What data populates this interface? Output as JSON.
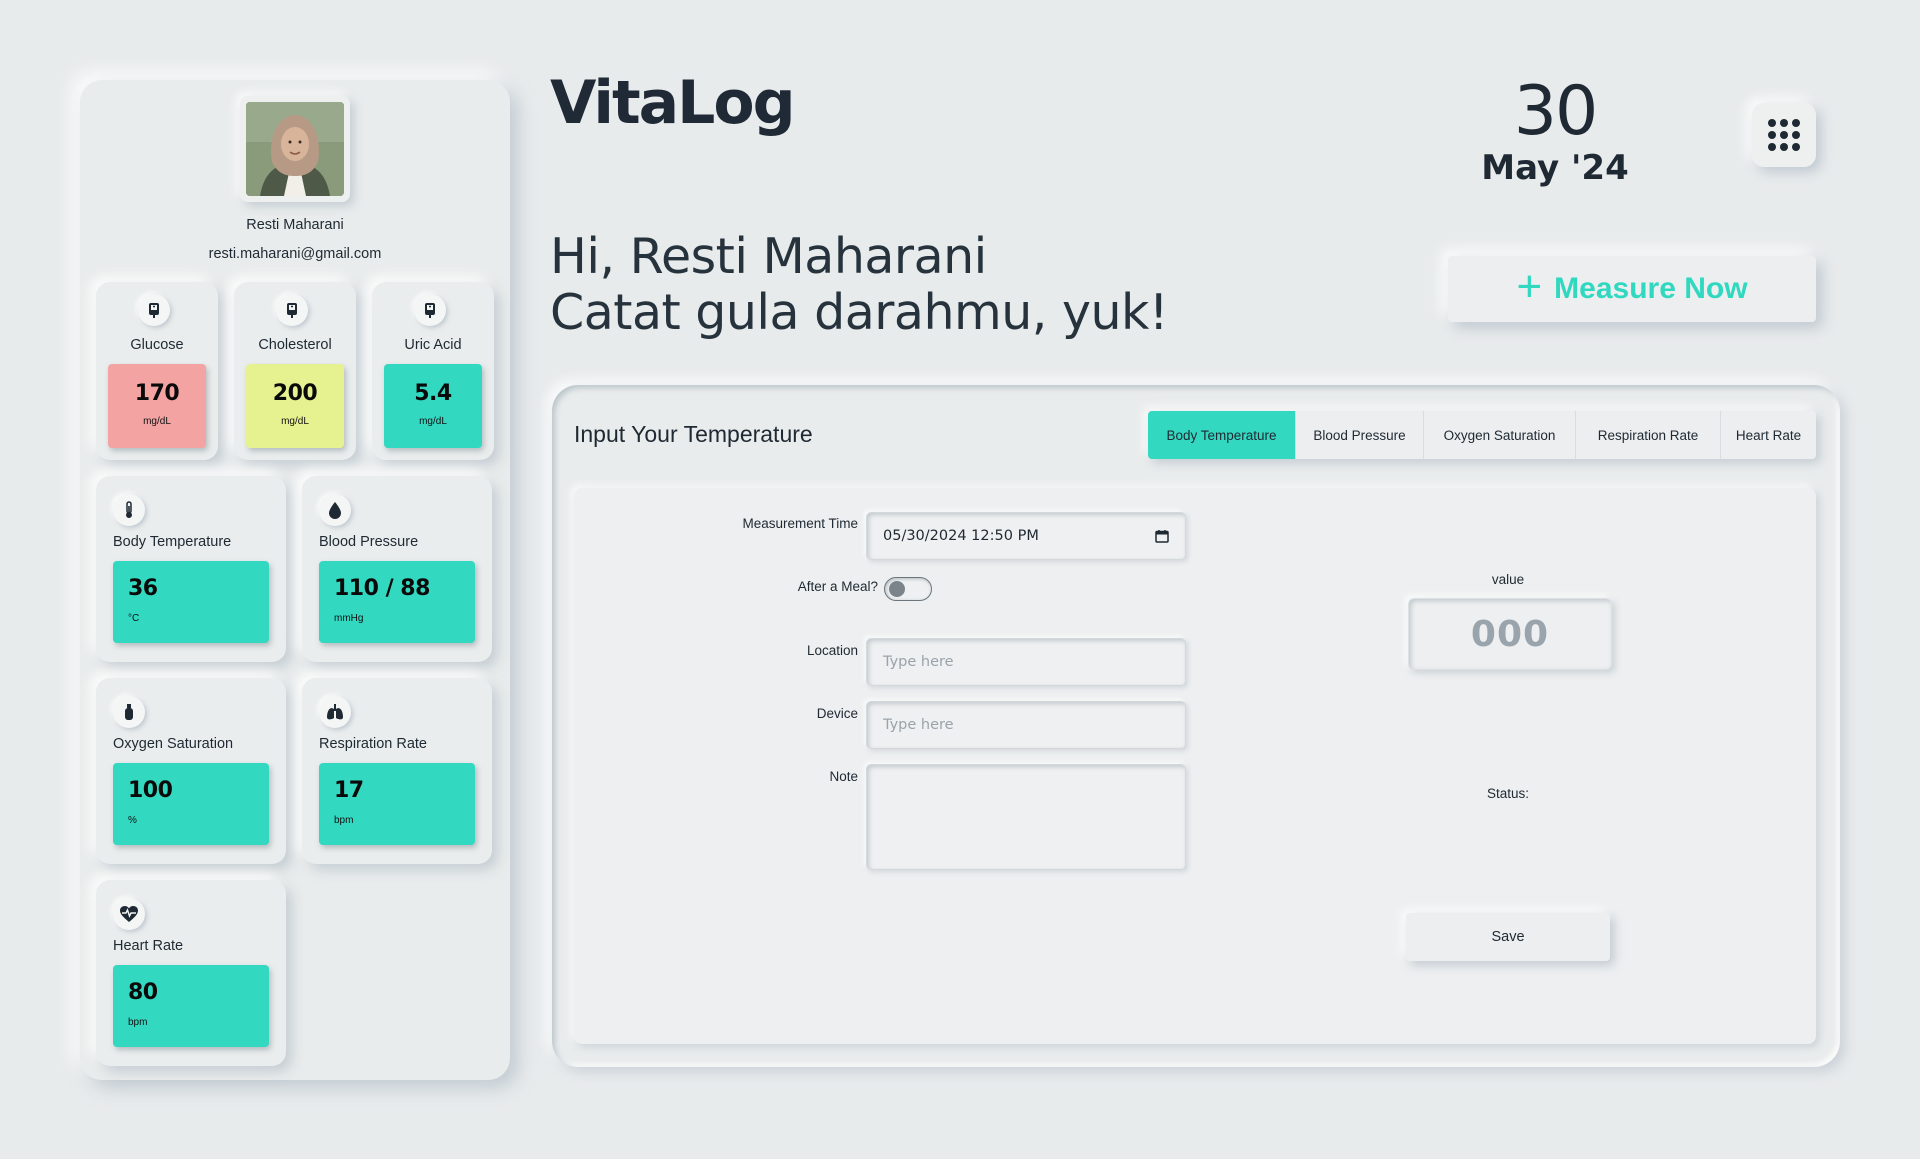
{
  "app": {
    "logo": "VitaLog"
  },
  "date": {
    "day": "30",
    "month_year": "May '24"
  },
  "user": {
    "name": "Resti Maharani",
    "email": "resti.maharani@gmail.com"
  },
  "greeting": {
    "line1": "Hi, Resti Maharani",
    "line2": "Catat gula darahmu, yuk!"
  },
  "measure_button": {
    "label": "Measure Now",
    "icon": "plus-icon"
  },
  "colors": {
    "accent": "#33d8c1",
    "glucose_alert": "#f4a3a3",
    "cholesterol_warn": "#e6f28f",
    "normal": "#33d8c1"
  },
  "metrics_small": [
    {
      "label": "Glucose",
      "value": "170",
      "unit": "mg/dL",
      "icon": "blood-bag-icon",
      "color": "#f4a3a3"
    },
    {
      "label": "Cholesterol",
      "value": "200",
      "unit": "mg/dL",
      "icon": "blood-bag-icon",
      "color": "#e6f28f"
    },
    {
      "label": "Uric Acid",
      "value": "5.4",
      "unit": "mg/dL",
      "icon": "blood-bag-icon",
      "color": "#33d8c1"
    }
  ],
  "metrics_big": [
    {
      "label": "Body Temperature",
      "value": "36",
      "unit": "°C",
      "icon": "thermometer-icon"
    },
    {
      "label": "Blood Pressure",
      "value": "110 / 88",
      "unit": "mmHg",
      "icon": "blood-drop-icon"
    },
    {
      "label": "Oxygen Saturation",
      "value": "100",
      "unit": "%",
      "icon": "oxygen-tank-icon"
    },
    {
      "label": "Respiration Rate",
      "value": "17",
      "unit": "bpm",
      "icon": "lungs-icon"
    },
    {
      "label": "Heart Rate",
      "value": "80",
      "unit": "bpm",
      "icon": "heart-pulse-icon"
    }
  ],
  "panel": {
    "title": "Input Your Temperature",
    "tabs": [
      {
        "label": "Body Temperature",
        "active": true
      },
      {
        "label": "Blood Pressure",
        "active": false
      },
      {
        "label": "Oxygen Saturation",
        "active": false
      },
      {
        "label": "Respiration Rate",
        "active": false
      },
      {
        "label": "Heart Rate",
        "active": false
      }
    ],
    "form": {
      "measurement_time_label": "Measurement Time",
      "measurement_time_value": "05/30/2024 12:50 PM",
      "after_meal_label": "After a Meal?",
      "after_meal_on": false,
      "location_label": "Location",
      "location_placeholder": "Type here",
      "device_label": "Device",
      "device_placeholder": "Type here",
      "note_label": "Note",
      "value_label": "value",
      "value_placeholder": "000",
      "status_label": "Status:",
      "save_label": "Save"
    }
  }
}
